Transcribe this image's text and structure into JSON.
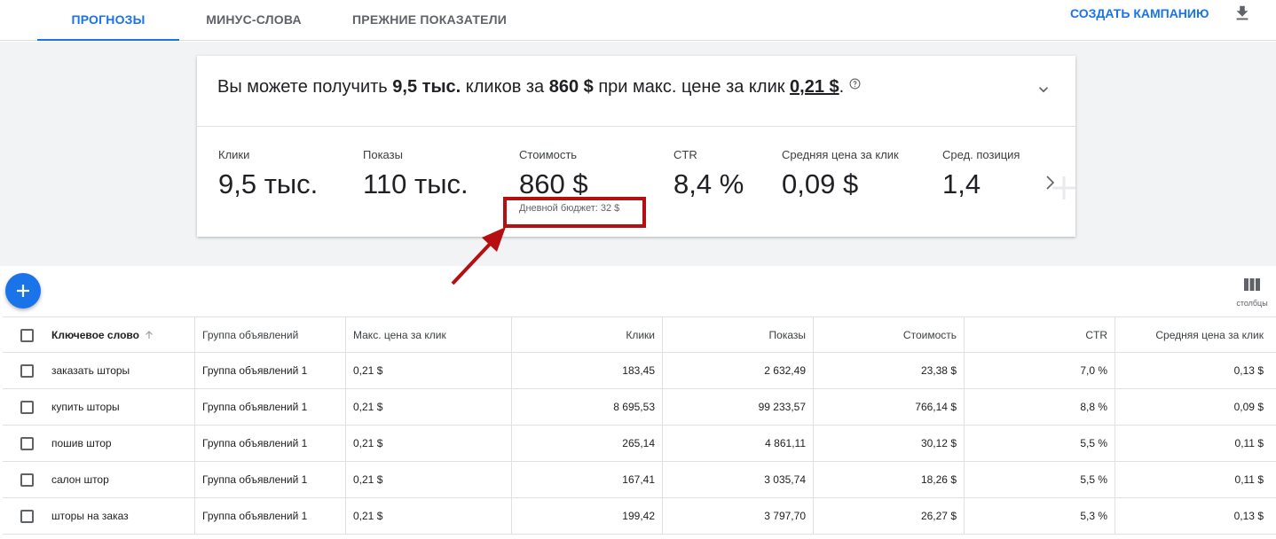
{
  "tabs": [
    {
      "label": "Прогнозы",
      "active": true
    },
    {
      "label": "Минус-слова",
      "active": false
    },
    {
      "label": "Прежние показатели",
      "active": false
    }
  ],
  "header": {
    "create_campaign": "Создать кампанию",
    "download_icon": "download-icon"
  },
  "summary": {
    "prefix": "Вы можете получить ",
    "clicks": "9,5 тыс.",
    "mid1": " кликов за ",
    "cost": "860 $",
    "mid2": " при макс. цене за клик ",
    "bid": "0,21 $",
    "suffix": "."
  },
  "metrics": [
    {
      "label": "Клики",
      "value": "9,5 тыс."
    },
    {
      "label": "Показы",
      "value": "110 тыс."
    },
    {
      "label": "Стоимость",
      "value": "860 $"
    },
    {
      "label": "CTR",
      "value": "8,4 %"
    },
    {
      "label": "Средняя цена за клик",
      "value": "0,09 $"
    },
    {
      "label": "Сред. позиция",
      "value": "1,4"
    }
  ],
  "budget_note": "Дневной бюджет: 32 $",
  "columns_label": "столбцы",
  "table": {
    "headers": {
      "keyword": "Ключевое слово",
      "group": "Группа объявлений",
      "bid": "Макс. цена за клик",
      "clicks": "Клики",
      "impressions": "Показы",
      "cost": "Стоимость",
      "ctr": "CTR",
      "cpc": "Средняя цена за клик"
    },
    "rows": [
      {
        "keyword": "заказать шторы",
        "group": "Группа объявлений 1",
        "bid": "0,21 $",
        "clicks": "183,45",
        "impressions": "2 632,49",
        "cost": "23,38 $",
        "ctr": "7,0 %",
        "cpc": "0,13 $"
      },
      {
        "keyword": "купить шторы",
        "group": "Группа объявлений 1",
        "bid": "0,21 $",
        "clicks": "8 695,53",
        "impressions": "99 233,57",
        "cost": "766,14 $",
        "ctr": "8,8 %",
        "cpc": "0,09 $"
      },
      {
        "keyword": "пошив штор",
        "group": "Группа объявлений 1",
        "bid": "0,21 $",
        "clicks": "265,14",
        "impressions": "4 861,11",
        "cost": "30,12 $",
        "ctr": "5,5 %",
        "cpc": "0,11 $"
      },
      {
        "keyword": "салон штор",
        "group": "Группа объявлений 1",
        "bid": "0,21 $",
        "clicks": "167,41",
        "impressions": "3 035,74",
        "cost": "18,26 $",
        "ctr": "5,5 %",
        "cpc": "0,11 $"
      },
      {
        "keyword": "шторы на заказ",
        "group": "Группа объявлений 1",
        "bid": "0,21 $",
        "clicks": "199,42",
        "impressions": "3 797,70",
        "cost": "26,27 $",
        "ctr": "5,3 %",
        "cpc": "0,13 $"
      }
    ]
  },
  "colors": {
    "accent": "#1a73e8",
    "annotation": "#b50f11",
    "band": "#f1f3f4"
  }
}
